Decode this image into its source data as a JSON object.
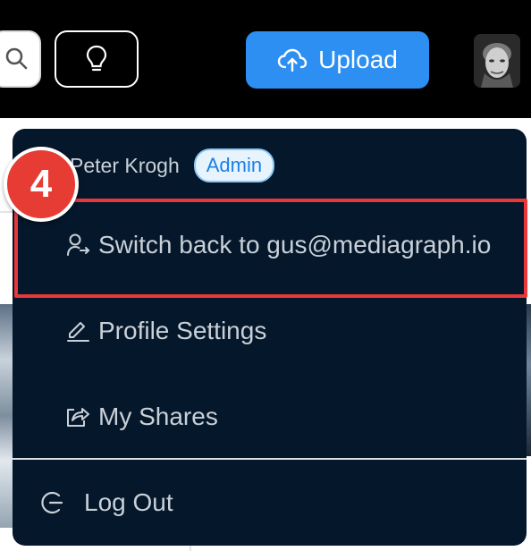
{
  "topbar": {
    "upload_label": "Upload",
    "upload_color": "#2d8ff1"
  },
  "dropdown": {
    "user_name": "Peter Krogh",
    "role_badge": "Admin",
    "items": [
      {
        "label": "Switch back to gus@mediagraph.io",
        "icon": "user-switch-icon"
      },
      {
        "label": "Profile Settings",
        "icon": "pencil-icon"
      },
      {
        "label": "My Shares",
        "icon": "share-icon"
      },
      {
        "label": "Log Out",
        "icon": "logout-icon"
      }
    ]
  },
  "annotation": {
    "step_number": "4",
    "color": "#e73c34"
  }
}
